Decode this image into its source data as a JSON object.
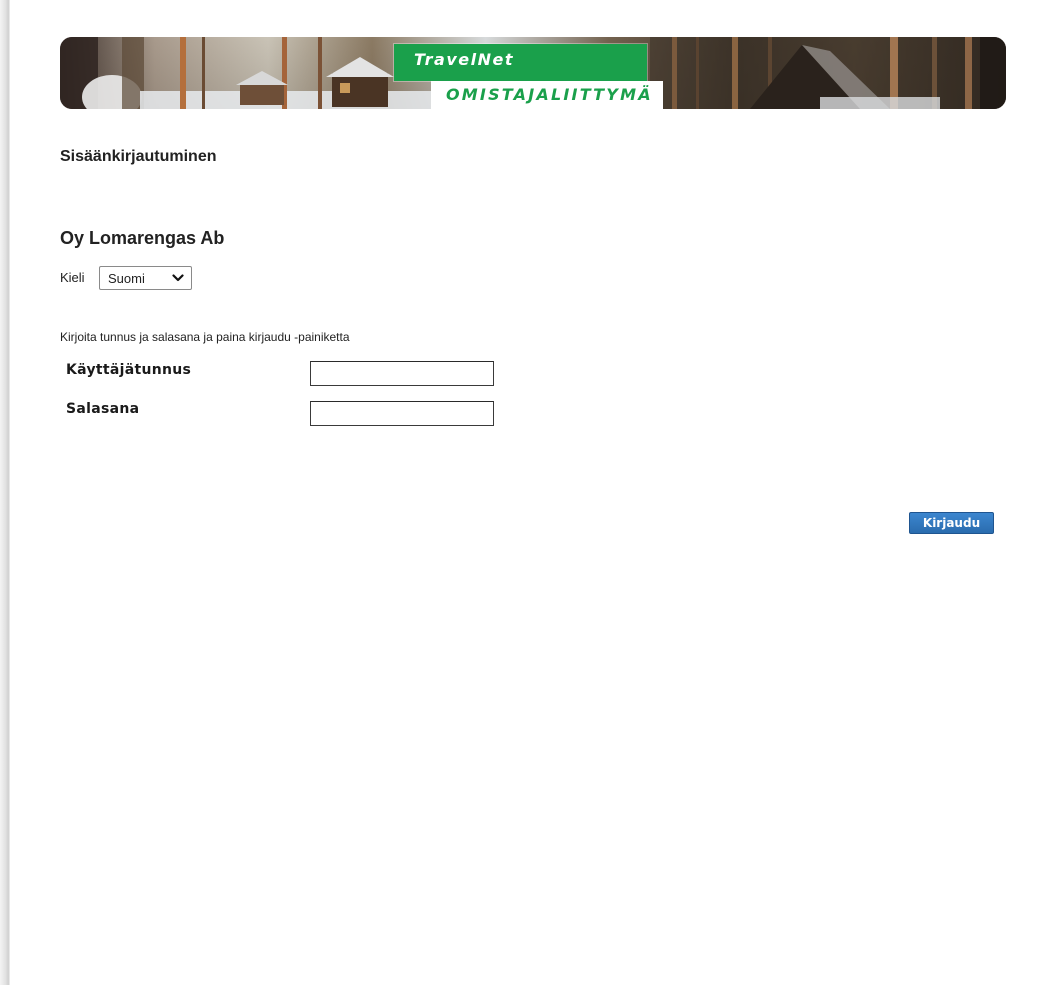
{
  "banner": {
    "logo_primary": "TravelNet",
    "logo_secondary": "OMISTAJALIITTYMÄ",
    "colors": {
      "logo_green": "#1aa04b",
      "logo_white": "#ffffff"
    }
  },
  "page": {
    "title": "Sisäänkirjautuminen",
    "company": "Oy Lomarengas Ab"
  },
  "language": {
    "label": "Kieli",
    "selected": "Suomi",
    "icon": "chevron-down-icon"
  },
  "login_form": {
    "instructions": "Kirjoita tunnus ja salasana ja paina kirjaudu -painiketta",
    "username_label": "Käyttäjätunnus",
    "username_value": "",
    "password_label": "Salasana",
    "password_value": "",
    "submit_label": "Kirjaudu",
    "submit_color": "#2f74b8"
  }
}
